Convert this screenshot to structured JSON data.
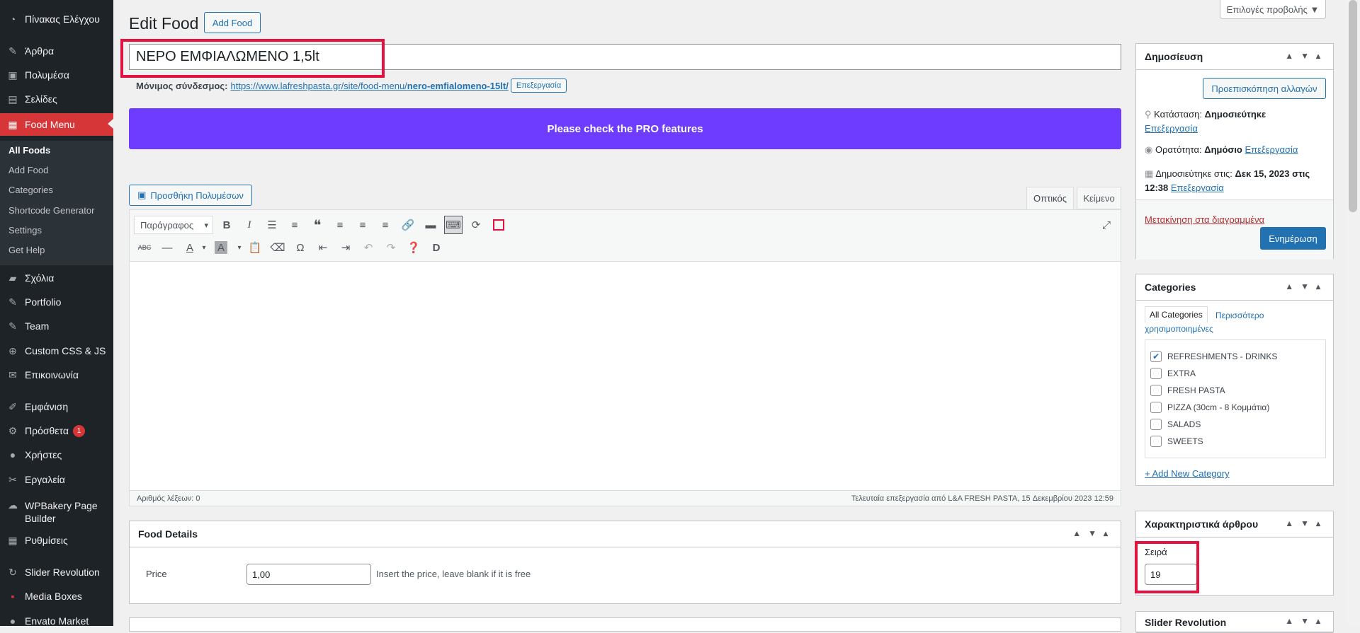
{
  "sidebar": {
    "items": [
      {
        "label": "Πίνακας Ελέγχου",
        "icon": "dashboard-icon"
      },
      {
        "label": "Άρθρα",
        "icon": "pin-icon"
      },
      {
        "label": "Πολυμέσα",
        "icon": "media-icon"
      },
      {
        "label": "Σελίδες",
        "icon": "pages-icon"
      },
      {
        "label": "Food Menu",
        "icon": "food-menu-icon"
      },
      {
        "label": "Σχόλια",
        "icon": "comments-icon"
      },
      {
        "label": "Portfolio",
        "icon": "pin-icon"
      },
      {
        "label": "Team",
        "icon": "pin-icon"
      },
      {
        "label": "Custom CSS & JS",
        "icon": "plus-icon"
      },
      {
        "label": "Επικοινωνία",
        "icon": "mail-icon"
      },
      {
        "label": "Εμφάνιση",
        "icon": "appearance-icon"
      },
      {
        "label": "Πρόσθετα",
        "icon": "plugins-icon",
        "badge": "1"
      },
      {
        "label": "Χρήστες",
        "icon": "users-icon"
      },
      {
        "label": "Εργαλεία",
        "icon": "tools-icon"
      },
      {
        "label": "WPBakery Page Builder",
        "icon": "wpbakery-icon"
      },
      {
        "label": "Ρυθμίσεις",
        "icon": "settings-icon"
      },
      {
        "label": "Slider Revolution",
        "icon": "slider-icon"
      },
      {
        "label": "Media Boxes",
        "icon": "mediaboxes-icon"
      },
      {
        "label": "Envato Market",
        "icon": "envato-icon"
      }
    ],
    "submenu": [
      "All Foods",
      "Add Food",
      "Categories",
      "Shortcode Generator",
      "Settings",
      "Get Help"
    ]
  },
  "header": {
    "title": "Edit Food",
    "add_button": "Add Food",
    "screen_options": "Επιλογές προβολής ▼"
  },
  "post": {
    "title_value": "ΝΕΡΟ ΕΜΦΙΑΛΩΜΕΝΟ 1,5lt",
    "permalink_label": "Μόνιμος σύνδεσμος:",
    "permalink_base": "https://www.lafreshpasta.gr/site/food-menu/",
    "permalink_slug": "nero-emfialomeno-15lt/",
    "permalink_edit": "Επεξεργασία",
    "pro_banner": "Please check the PRO features"
  },
  "editor": {
    "add_media": "Προσθήκη Πολυμέσων",
    "tab_visual": "Οπτικός",
    "tab_text": "Κείμενο",
    "format_select": "Παράγραφος",
    "word_count": "Αριθμός λέξεων: 0",
    "last_edited": "Τελευταία επεξεργασία από L&A FRESH PASTA, 15 Δεκεμβρίου 2023 12:59"
  },
  "food_details": {
    "title": "Food Details",
    "price_label": "Price",
    "price_value": "1,00",
    "price_hint": "Insert the price, leave blank if it is free"
  },
  "publish": {
    "title": "Δημοσίευση",
    "preview": "Προεπισκόπηση αλλαγών",
    "status_label": "Κατάσταση:",
    "status_value": "Δημοσιεύτηκε",
    "visibility_label": "Ορατότητα:",
    "visibility_value": "Δημόσιο",
    "published_label": "Δημοσιεύτηκε στις:",
    "published_value": "Δεκ 15, 2023 στις",
    "published_time": "12:38",
    "edit": "Επεξεργασία",
    "trash": "Μετακίνηση στα διαγραμμένα",
    "update": "Ενημέρωση"
  },
  "categories": {
    "title": "Categories",
    "tab_all": "All Categories",
    "tab_popular": "Περισσότερο χρησιμοποιημένες",
    "items": [
      {
        "label": "REFRESHMENTS - DRINKS",
        "checked": true
      },
      {
        "label": "EXTRA",
        "checked": false
      },
      {
        "label": "FRESH PASTA",
        "checked": false
      },
      {
        "label": "PIZZA (30cm - 8 Κομμάτια)",
        "checked": false
      },
      {
        "label": "SALADS",
        "checked": false
      },
      {
        "label": "SWEETS",
        "checked": false
      }
    ],
    "add_new": "+ Add New Category"
  },
  "attributes": {
    "title": "Χαρακτηριστικά άρθρου",
    "order_label": "Σειρά",
    "order_value": "19"
  },
  "slider_box": {
    "title": "Slider Revolution"
  },
  "colors": {
    "highlight": "#e4123e",
    "pro_banner": "#6d3cff",
    "accent": "#2271b1",
    "active_menu": "#d63638"
  }
}
